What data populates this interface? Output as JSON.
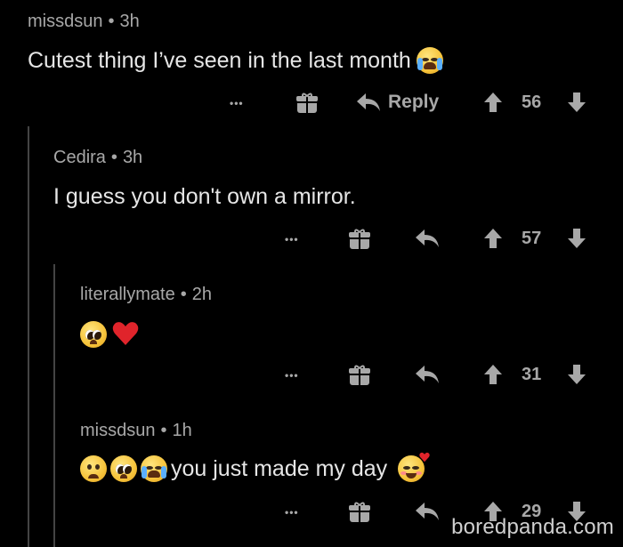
{
  "comments": [
    {
      "username": "missdsun",
      "time": "3h",
      "text": "Cutest thing I’ve seen in the last month",
      "reply_label": "Reply",
      "score": "56",
      "emojis": [
        "loudly-crying-face"
      ]
    },
    {
      "username": "Cedira",
      "time": "3h",
      "text": "I guess you don't own a mirror.",
      "score": "57"
    },
    {
      "username": "literallymate",
      "time": "2h",
      "emojis": [
        "pleading-face",
        "red-heart"
      ],
      "score": "31"
    },
    {
      "username": "missdsun",
      "time": "1h",
      "text": "you just made my day",
      "emojis_before": [
        "frowning-face",
        "pleading-face",
        "loudly-crying-face"
      ],
      "emojis_after": [
        "smiling-face-with-hearts"
      ],
      "score": "29"
    }
  ],
  "separator": "•",
  "more_label": "•••",
  "icons": [
    "more-icon",
    "gift-icon",
    "reply-arrow-icon",
    "upvote-icon",
    "downvote-icon"
  ],
  "watermark": "boredpanda.com",
  "colors": {
    "background": "#000000",
    "text": "#e6e6e6",
    "muted": "#a8a8a8",
    "thread_line": "#444444",
    "heart": "#e0242b"
  }
}
